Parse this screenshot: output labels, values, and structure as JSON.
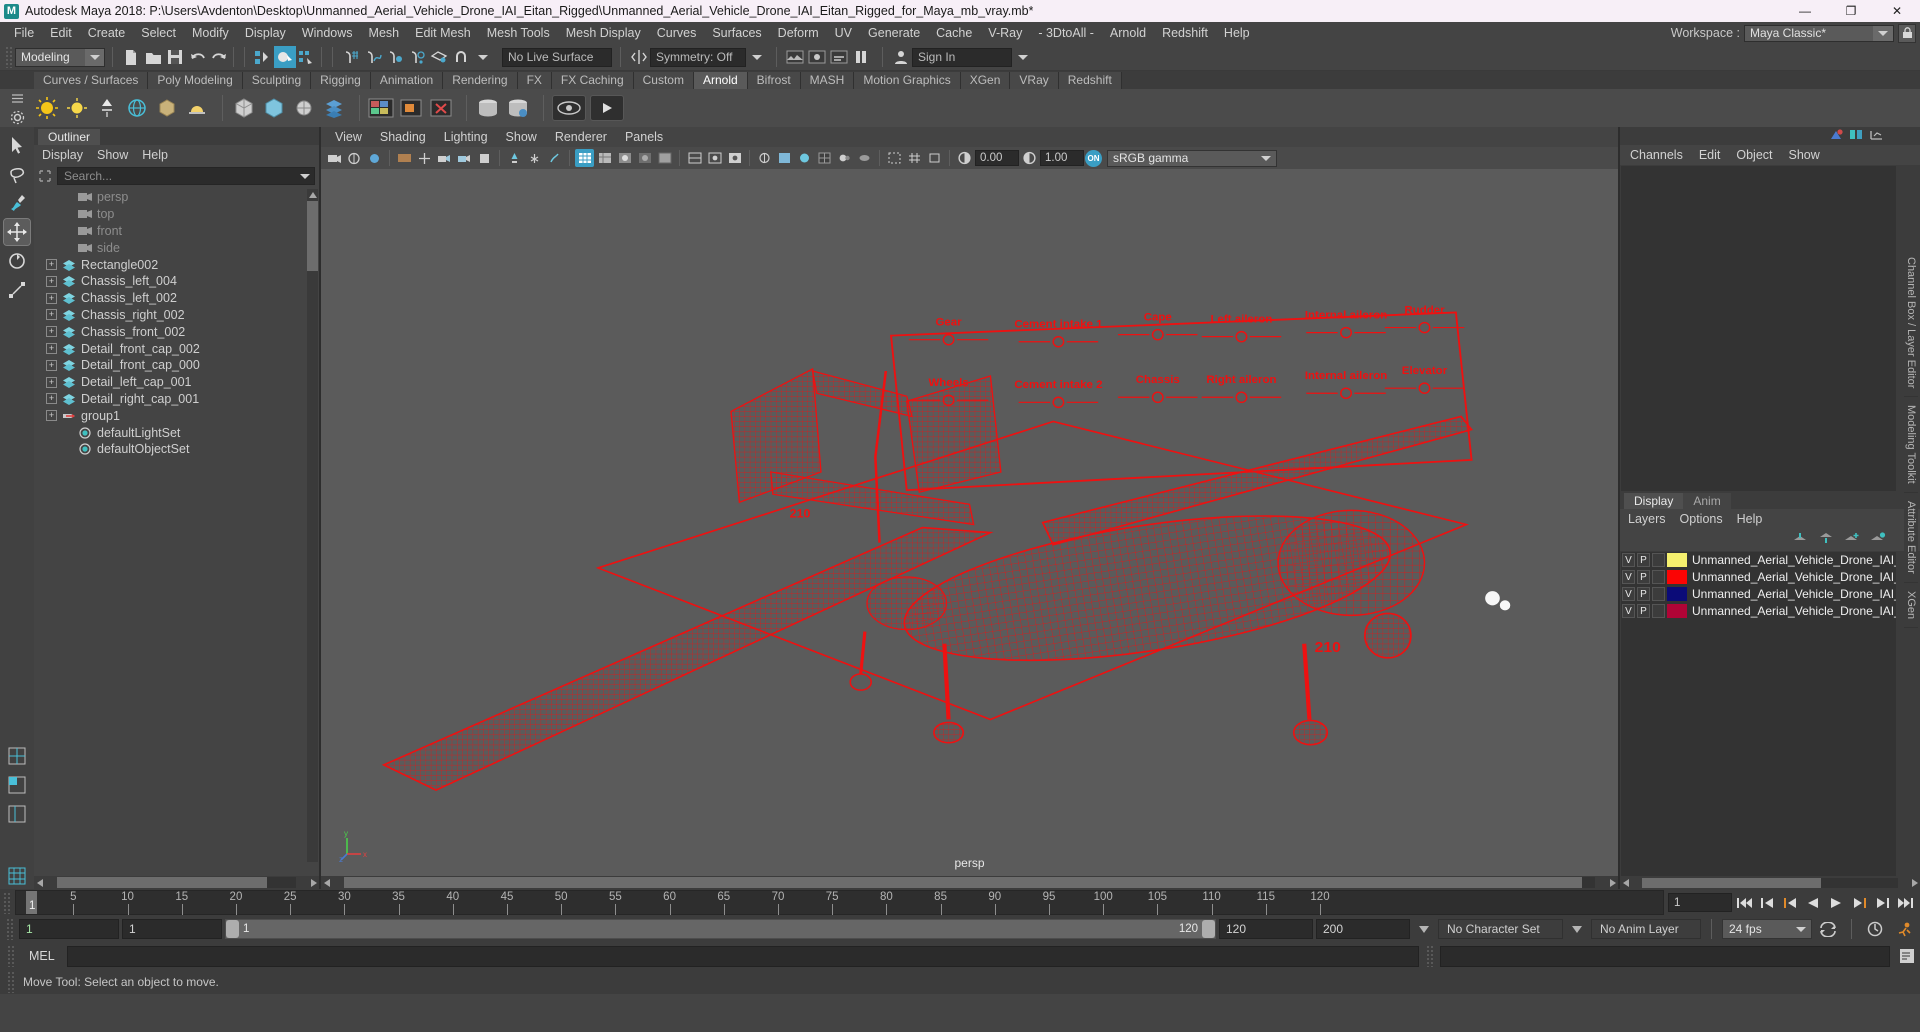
{
  "titlebar": {
    "title": "Autodesk Maya 2018: P:\\Users\\Avdenton\\Desktop\\Unmanned_Aerial_Vehicle_Drone_IAI_Eitan_Rigged\\Unmanned_Aerial_Vehicle_Drone_IAI_Eitan_Rigged_for_Maya_mb_vray.mb*",
    "logo": "M",
    "minimize": "—",
    "maximize": "❐",
    "close": "✕"
  },
  "menubar": {
    "items": [
      "File",
      "Edit",
      "Create",
      "Select",
      "Modify",
      "Display",
      "Windows",
      "Mesh",
      "Edit Mesh",
      "Mesh Tools",
      "Mesh Display",
      "Curves",
      "Surfaces",
      "Deform",
      "UV",
      "Generate",
      "Cache",
      "V-Ray",
      "- 3DtoAll -",
      "Arnold",
      "Redshift",
      "Help"
    ],
    "workspace_label": "Workspace :",
    "workspace_value": "Maya Classic*"
  },
  "statusline": {
    "menuset": "Modeling",
    "live_surface": "No Live Surface",
    "symmetry": "Symmetry: Off",
    "sign_in": "Sign In"
  },
  "shelf": {
    "tabs": [
      "Curves / Surfaces",
      "Poly Modeling",
      "Sculpting",
      "Rigging",
      "Animation",
      "Rendering",
      "FX",
      "FX Caching",
      "Custom",
      "Arnold",
      "Bifrost",
      "MASH",
      "Motion Graphics",
      "XGen",
      "VRay",
      "Redshift"
    ],
    "active_tab": "Arnold"
  },
  "outliner": {
    "tab": "Outliner",
    "menus": [
      "Display",
      "Show",
      "Help"
    ],
    "search_placeholder": "Search...",
    "items": [
      {
        "label": "persp",
        "type": "camera",
        "expandable": false
      },
      {
        "label": "top",
        "type": "camera",
        "expandable": false
      },
      {
        "label": "front",
        "type": "camera",
        "expandable": false
      },
      {
        "label": "side",
        "type": "camera",
        "expandable": false
      },
      {
        "label": "Rectangle002",
        "type": "mesh",
        "expandable": true
      },
      {
        "label": "Chassis_left_004",
        "type": "mesh",
        "expandable": true
      },
      {
        "label": "Chassis_left_002",
        "type": "mesh",
        "expandable": true
      },
      {
        "label": "Chassis_right_002",
        "type": "mesh",
        "expandable": true
      },
      {
        "label": "Chassis_front_002",
        "type": "mesh",
        "expandable": true
      },
      {
        "label": "Detail_front_cap_002",
        "type": "mesh",
        "expandable": true
      },
      {
        "label": "Detail_front_cap_000",
        "type": "mesh",
        "expandable": true
      },
      {
        "label": "Detail_left_cap_001",
        "type": "mesh",
        "expandable": true
      },
      {
        "label": "Detail_right_cap_001",
        "type": "mesh",
        "expandable": true
      },
      {
        "label": "group1",
        "type": "group",
        "expandable": true
      },
      {
        "label": "defaultLightSet",
        "type": "set",
        "expandable": false
      },
      {
        "label": "defaultObjectSet",
        "type": "set",
        "expandable": false
      }
    ]
  },
  "viewport": {
    "menus": [
      "View",
      "Shading",
      "Lighting",
      "Show",
      "Renderer",
      "Panels"
    ],
    "exposure": "0.00",
    "gamma": "1.00",
    "colorspace": "sRGB gamma",
    "colorspace_toggle": "ON",
    "camera_label": "persp",
    "axis": {
      "x": "x",
      "y": "y",
      "z": "z"
    },
    "model_labels": [
      "Gear",
      "Cement intake 1",
      "Cape",
      "Left aileron",
      "Internal aileron",
      "Rudder",
      "Wheels",
      "Cement intake 2",
      "Chassis",
      "Right aileron",
      "Internal aileron",
      "Elevator"
    ],
    "tail_number": "210",
    "body_number": "210"
  },
  "channelbox": {
    "menus": [
      "Channels",
      "Edit",
      "Object",
      "Show"
    ],
    "side_tabs": [
      "Channel Box / Layer Editor",
      "Modeling Toolkit",
      "Attribute Editor",
      "XGen"
    ]
  },
  "layereditor": {
    "tabs": [
      "Display",
      "Anim"
    ],
    "active_tab": "Display",
    "menus": [
      "Layers",
      "Options",
      "Help"
    ],
    "layers": [
      {
        "v": "V",
        "p": "P",
        "color": "#f5f06e",
        "name": "Unmanned_Aerial_Vehicle_Drone_IAI_Eitan_Rigged_l"
      },
      {
        "v": "V",
        "p": "P",
        "color": "#fb0404",
        "name": "Unmanned_Aerial_Vehicle_Drone_IAI_Eitan_Rigged_"
      },
      {
        "v": "V",
        "p": "P",
        "color": "#0b0b78",
        "name": "Unmanned_Aerial_Vehicle_Drone_IAI_Eitan_Rigged_l"
      },
      {
        "v": "V",
        "p": "P",
        "color": "#b00436",
        "name": "Unmanned_Aerial_Vehicle_Drone_IAI_Eitan_Rigged_("
      }
    ]
  },
  "timeline": {
    "ticks": [
      5,
      10,
      15,
      20,
      25,
      30,
      35,
      40,
      45,
      50,
      55,
      60,
      65,
      70,
      75,
      80,
      85,
      90,
      95,
      100,
      105,
      110,
      115,
      120
    ],
    "start": 1,
    "end": 120,
    "current_frame": "1",
    "current_frame_label": "1"
  },
  "range": {
    "anim_start": "1",
    "range_start": "1",
    "slider_start": "1",
    "slider_end": "120",
    "range_end": "120",
    "anim_end": "200",
    "character_set": "No Character Set",
    "anim_layer": "No Anim Layer",
    "fps": "24 fps"
  },
  "mel": {
    "label": "MEL",
    "input_value": "",
    "output_value": ""
  },
  "statusbar": {
    "message": "Move Tool: Select an object to move."
  }
}
